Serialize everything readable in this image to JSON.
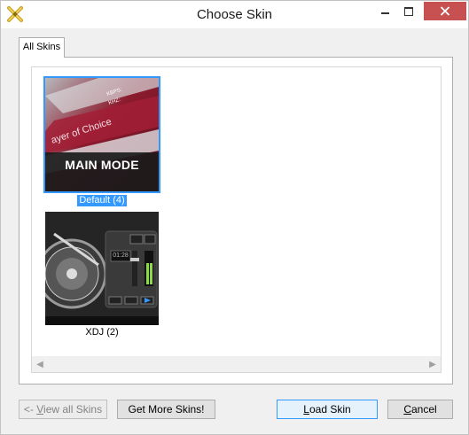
{
  "window": {
    "title": "Choose Skin",
    "icon": "x-logo-icon"
  },
  "tabs": [
    {
      "label": "All Skins"
    }
  ],
  "skins": [
    {
      "thumbnail_caption": "MAIN MODE",
      "label": "Default (4)",
      "selected": true
    },
    {
      "thumbnail_time": "01:28",
      "label": "XDJ (2)",
      "selected": false
    }
  ],
  "buttons": {
    "view_all_prefix": "<- ",
    "view_all_u": "V",
    "view_all_rest": "iew all Skins",
    "get_more": "Get More Skins!",
    "load_u": "L",
    "load_rest": "oad Skin",
    "cancel_u": "C",
    "cancel_rest": "ancel"
  },
  "colors": {
    "selection": "#3399ff",
    "close_button": "#c75050"
  }
}
